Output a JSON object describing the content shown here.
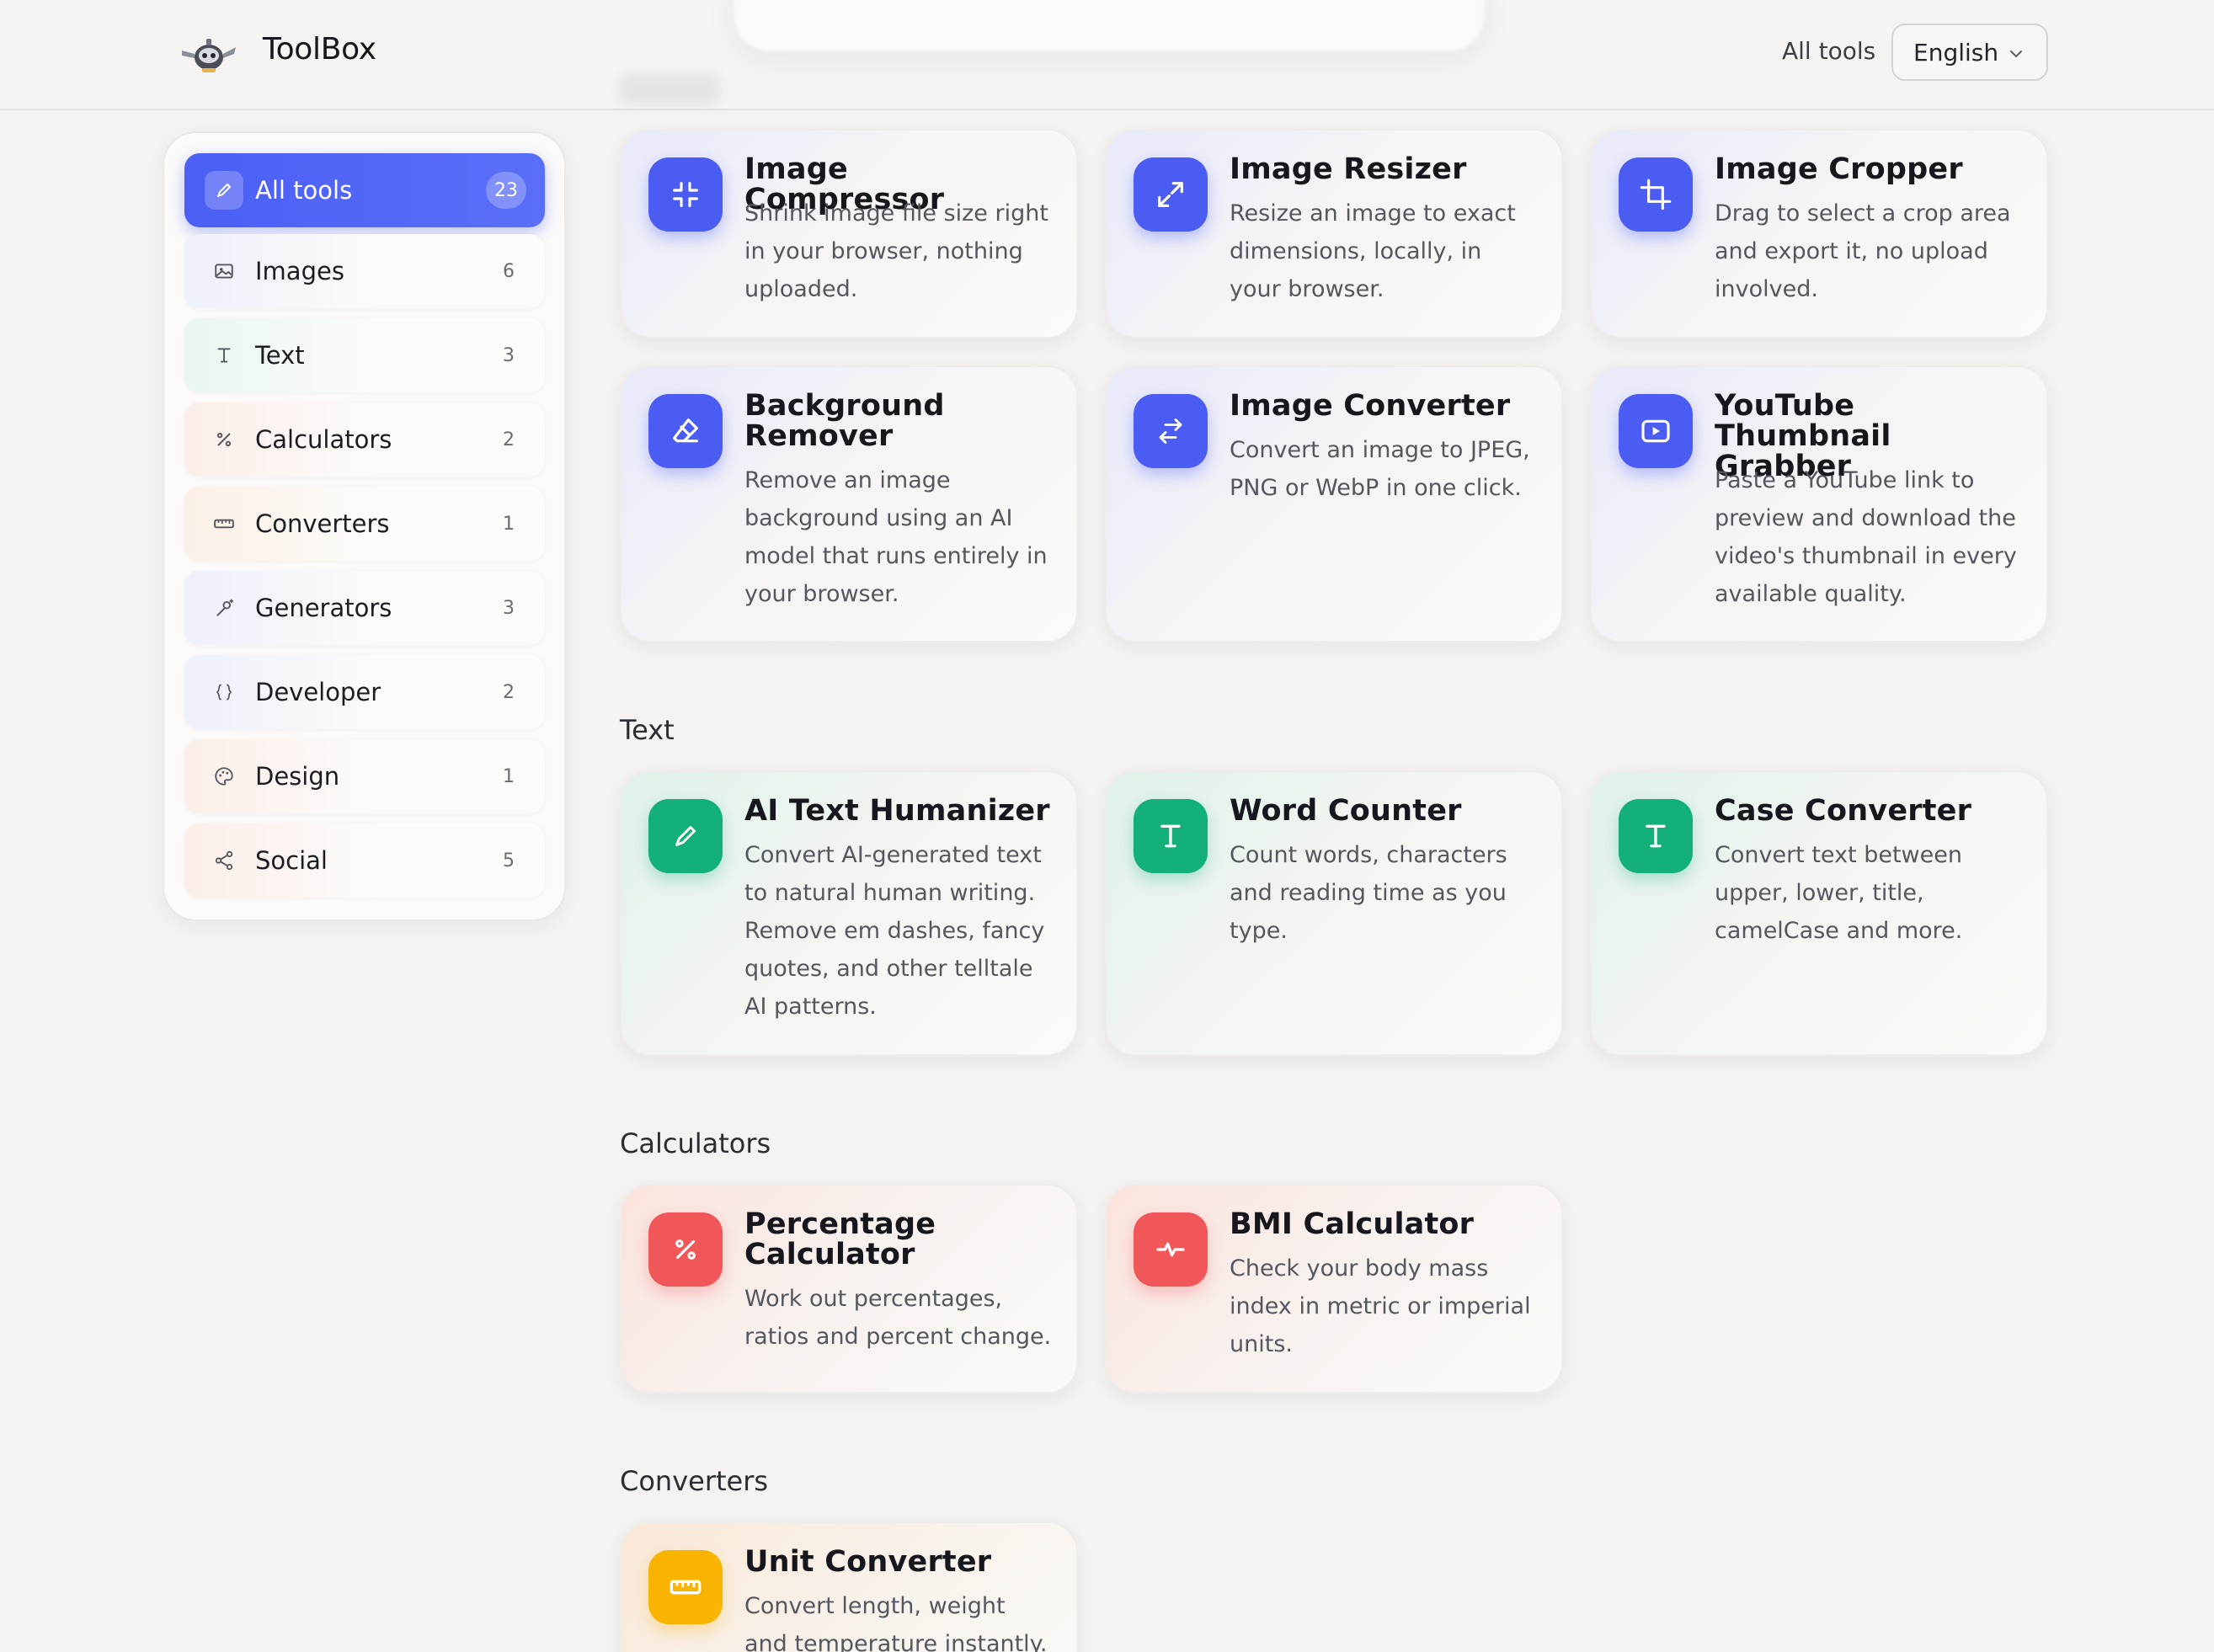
{
  "header": {
    "brand": "ToolBox",
    "nav_all_tools": "All tools",
    "language": "English"
  },
  "sidebar": {
    "items": [
      {
        "label": "All tools",
        "count": "23",
        "icon": "pencil-icon"
      },
      {
        "label": "Images",
        "count": "6",
        "icon": "image-icon"
      },
      {
        "label": "Text",
        "count": "3",
        "icon": "text-icon"
      },
      {
        "label": "Calculators",
        "count": "2",
        "icon": "percent-icon"
      },
      {
        "label": "Converters",
        "count": "1",
        "icon": "ruler-icon"
      },
      {
        "label": "Generators",
        "count": "3",
        "icon": "magic-wand-icon"
      },
      {
        "label": "Developer",
        "count": "2",
        "icon": "braces-icon"
      },
      {
        "label": "Design",
        "count": "1",
        "icon": "palette-icon"
      },
      {
        "label": "Social",
        "count": "5",
        "icon": "share-icon"
      }
    ]
  },
  "sections": {
    "text": "Text",
    "calculators": "Calculators",
    "converters": "Converters"
  },
  "cards": {
    "image_compressor": {
      "title": "Image Compressor",
      "desc": "Shrink image file size right in your browser, nothing uploaded.",
      "icon": "compress-icon"
    },
    "image_resizer": {
      "title": "Image Resizer",
      "desc": "Resize an image to exact dimensions, locally, in your browser.",
      "icon": "resize-icon"
    },
    "image_cropper": {
      "title": "Image Cropper",
      "desc": "Drag to select a crop area and export it, no upload involved.",
      "icon": "crop-icon"
    },
    "background_remover": {
      "title": "Background Remover",
      "desc": "Remove an image background using an AI model that runs entirely in your browser.",
      "icon": "eraser-icon"
    },
    "image_converter": {
      "title": "Image Converter",
      "desc": "Convert an image to JPEG, PNG or WebP in one click.",
      "icon": "swap-arrows-icon"
    },
    "youtube_thumbnail": {
      "title": "YouTube Thumbnail Grabber",
      "desc": "Paste a YouTube link to preview and download the video's thumbnail in every available quality.",
      "icon": "play-icon"
    },
    "ai_humanizer": {
      "title": "AI Text Humanizer",
      "desc": "Convert AI-generated text to natural human writing. Remove em dashes, fancy quotes, and other telltale AI patterns.",
      "icon": "pencil-icon"
    },
    "word_counter": {
      "title": "Word Counter",
      "desc": "Count words, characters and reading time as you type.",
      "icon": "text-icon"
    },
    "case_converter": {
      "title": "Case Converter",
      "desc": "Convert text between upper, lower, title, camelCase and more.",
      "icon": "text-icon"
    },
    "percentage_calc": {
      "title": "Percentage Calculator",
      "desc": "Work out percentages, ratios and percent change.",
      "icon": "percent-icon"
    },
    "bmi_calc": {
      "title": "BMI Calculator",
      "desc": "Check your body mass index in metric or imperial units.",
      "icon": "heartbeat-icon"
    },
    "unit_converter": {
      "title": "Unit Converter",
      "desc": "Convert length, weight and temperature instantly.",
      "icon": "ruler-icon"
    }
  },
  "colors": {
    "accent_blue": "#4a5cf2",
    "accent_green": "#13b07a",
    "accent_red": "#f15659",
    "accent_orange": "#f8b400"
  }
}
